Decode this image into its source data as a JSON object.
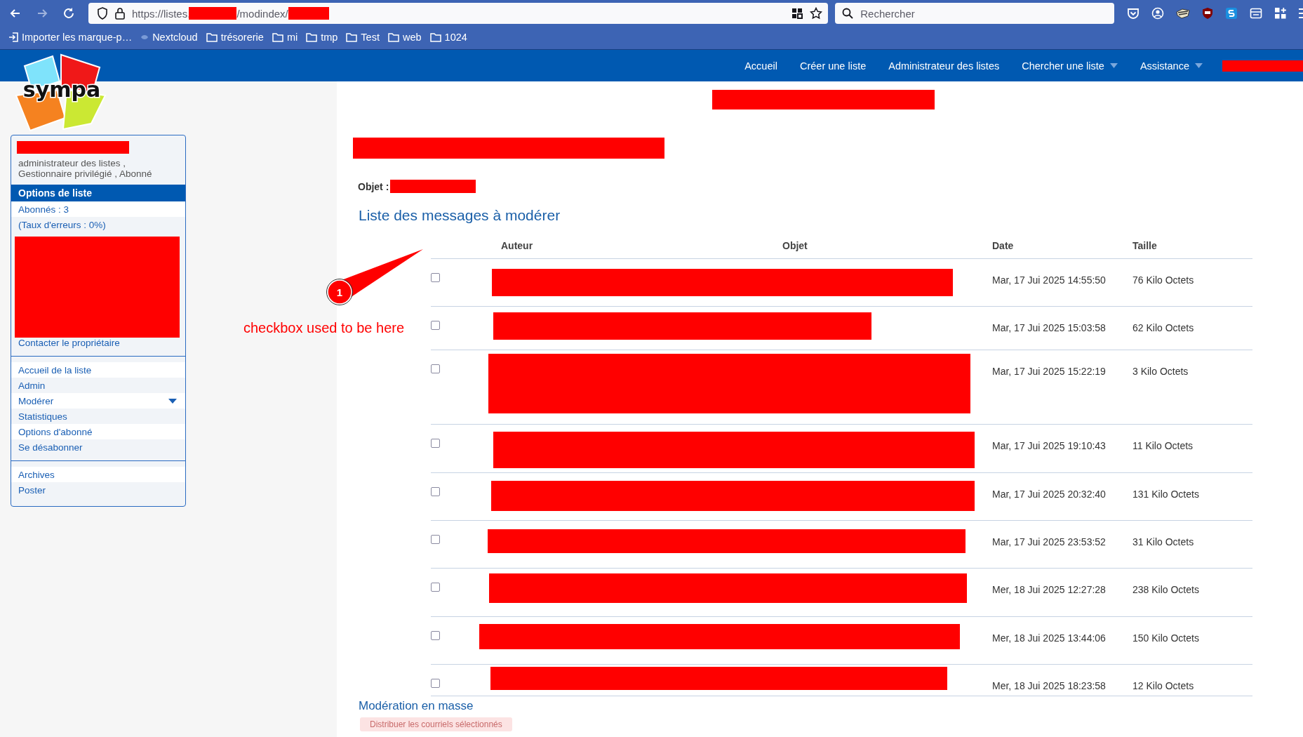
{
  "browser": {
    "url_parts": [
      "https://listes.",
      "/modindex/"
    ],
    "search": {
      "placeholder": "Rechercher"
    },
    "bookmarks": [
      {
        "label": "Importer les marque-p…",
        "kind": "import"
      },
      {
        "label": "Nextcloud",
        "kind": "site"
      },
      {
        "label": "trésorerie",
        "kind": "folder"
      },
      {
        "label": "mi",
        "kind": "folder"
      },
      {
        "label": "tmp",
        "kind": "folder"
      },
      {
        "label": "Test",
        "kind": "folder"
      },
      {
        "label": "web",
        "kind": "folder"
      },
      {
        "label": "1024",
        "kind": "folder"
      }
    ]
  },
  "navbar": {
    "logo": "sympa",
    "items": [
      {
        "label": "Accueil",
        "dropdown": false
      },
      {
        "label": "Créer une liste",
        "dropdown": false
      },
      {
        "label": "Administrateur des listes",
        "dropdown": false
      },
      {
        "label": "Chercher une liste",
        "dropdown": true
      },
      {
        "label": "Assistance",
        "dropdown": true
      }
    ]
  },
  "sidebar": {
    "roles": [
      "administrateur des listes ,",
      "Gestionnaire privilégié , Abonné"
    ],
    "section_title": "Options de liste",
    "info_items": [
      "Abonnés : 3",
      "(Taux d'erreurs : 0%)"
    ],
    "contact": "Contacter le propriétaire",
    "menu": [
      {
        "label": "Accueil de la liste",
        "expandable": false
      },
      {
        "label": "Admin",
        "expandable": false
      },
      {
        "label": "Modérer",
        "expandable": true
      },
      {
        "label": "Statistiques",
        "expandable": false
      },
      {
        "label": "Options d'abonné",
        "expandable": false
      },
      {
        "label": "Se désabonner",
        "expandable": false
      }
    ],
    "menu2": [
      "Archives",
      "Poster"
    ]
  },
  "main": {
    "subject_label": "Objet :",
    "title": "Liste des messages à modérer",
    "columns": [
      "Auteur",
      "Objet",
      "Date",
      "Taille"
    ],
    "rows": [
      {
        "checked": false,
        "date": "Mar, 17 Jui 2025 14:55:50",
        "size": "76 Kilo Octets"
      },
      {
        "checked": false,
        "date": "Mar, 17 Jui 2025 15:03:58",
        "size": "62 Kilo Octets"
      },
      {
        "checked": false,
        "date": "Mar, 17 Jui 2025 15:22:19",
        "size": "3 Kilo Octets"
      },
      {
        "checked": false,
        "date": "Mar, 17 Jui 2025 19:10:43",
        "size": "11 Kilo Octets"
      },
      {
        "checked": false,
        "date": "Mar, 17 Jui 2025 20:32:40",
        "size": "131 Kilo Octets"
      },
      {
        "checked": false,
        "date": "Mar, 17 Jui 2025 23:53:52",
        "size": "31 Kilo Octets"
      },
      {
        "checked": false,
        "date": "Mer, 18 Jui 2025 12:27:28",
        "size": "238 Kilo Octets"
      },
      {
        "checked": false,
        "date": "Mer, 18 Jui 2025 13:44:06",
        "size": "150 Kilo Octets"
      },
      {
        "checked": false,
        "date": "Mer, 18 Jui 2025 18:23:58",
        "size": "12 Kilo Octets"
      }
    ],
    "bulk_title": "Modération en masse",
    "bulk_button": {
      "label": "Distribuer les courriels sélectionnés",
      "disabled": true
    }
  },
  "annotation": {
    "number": "1",
    "text": "checkbox used to be here"
  }
}
